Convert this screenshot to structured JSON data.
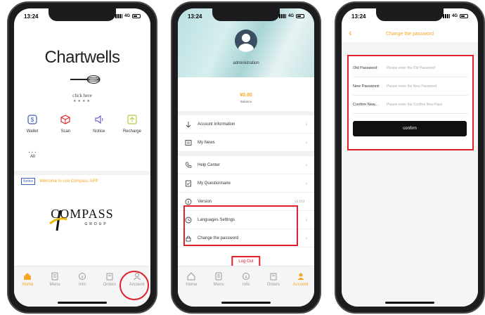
{
  "status": {
    "time": "13:24",
    "network": "4G"
  },
  "tabbar": {
    "items": [
      "Home",
      "Menu",
      "Info",
      "Orders",
      "Account"
    ]
  },
  "screen1": {
    "brand": "Chartwells",
    "tagline": "click here",
    "stars": "★★★★",
    "actions": [
      "Wallet",
      "Scan",
      "Notice",
      "Recharge"
    ],
    "all_label": "All",
    "notice_badge": "Notice",
    "notice_text": "Welcome to use Compass APP",
    "compass": "COMPASS",
    "group": "GROUP"
  },
  "screen2": {
    "admin": "administration",
    "balance_amount": "¥0.00",
    "balance_label": "Balance",
    "rows": [
      "Account Information",
      "My News",
      "Help Center",
      "My Questionnaire",
      "Version",
      "Languages Settings",
      "Change the password"
    ],
    "version_value": "v1.0.0",
    "logout": "Log Out"
  },
  "screen3": {
    "title": "Change the password",
    "fields": [
      {
        "label": "Old Password:",
        "placeholder": "Please enter the Old Password"
      },
      {
        "label": "New Password:",
        "placeholder": "Please enter the New Password"
      },
      {
        "label": "Confirm New...",
        "placeholder": "Please enter the Confirm New Pass"
      }
    ],
    "confirm": "confirm"
  },
  "colors": {
    "accent": "#f5a623",
    "highlight": "#e0212b",
    "button": "#0f0f0f",
    "tint": "#b9dfe2"
  }
}
